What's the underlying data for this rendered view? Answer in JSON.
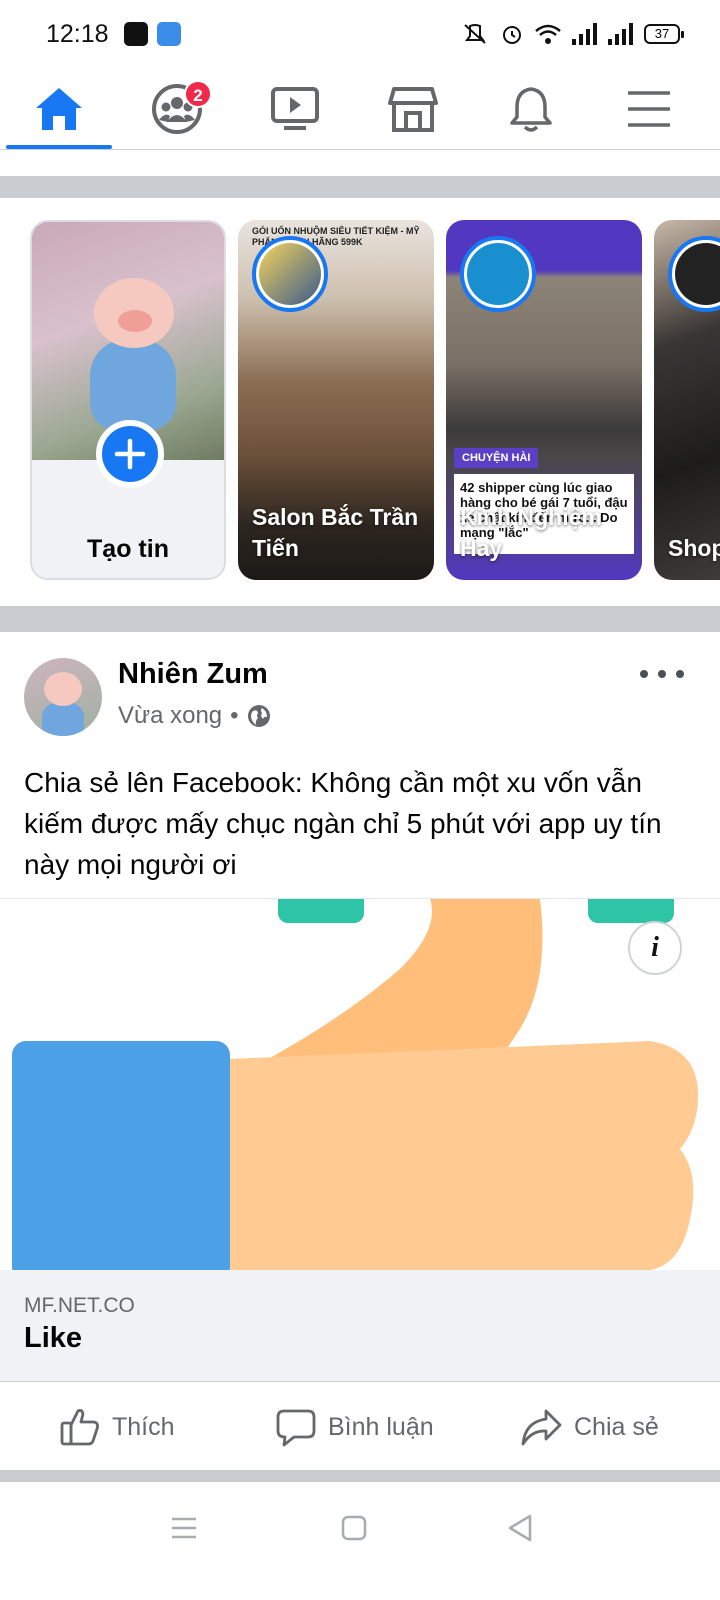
{
  "status_bar": {
    "time": "12:18",
    "battery": "37"
  },
  "nav": {
    "items": [
      {
        "icon": "home-icon",
        "active": true
      },
      {
        "icon": "groups-icon",
        "badge": "2"
      },
      {
        "icon": "watch-icon"
      },
      {
        "icon": "marketplace-icon"
      },
      {
        "icon": "bell-icon"
      },
      {
        "icon": "menu-icon"
      }
    ],
    "accent": "#1877f2"
  },
  "stories": {
    "create_label": "Tạo tin",
    "items": [
      {
        "name": "Salon Bắc Trần Tiến",
        "top_text": "GÓI UỐN NHUỘM SIÊU TIẾT KIỆM - MỸ PHẨM CHÍNH HÃNG 599K"
      },
      {
        "name": "Kinh Nghiệm Hay",
        "tag": "CHUYỆN HÀI",
        "caption": "42 shipper cùng lúc giao hàng cho bé gái 7 tuổi, đậu xe chật kín đến mức... Do mạng \"lắc\""
      },
      {
        "name": "Shop Xinh"
      }
    ]
  },
  "post": {
    "author": "Nhiên Zum",
    "time": "Vừa xong",
    "privacy_icon": "globe-icon",
    "text": "Chia sẻ lên Facebook: Không cần một xu vốn vẫn kiếm được mấy chục ngàn chỉ 5 phút với app uy tín này mọi người ơi",
    "link_domain": "MF.NET.CO",
    "link_title": "Like"
  },
  "actions": {
    "like": "Thích",
    "comment": "Bình luận",
    "share": "Chia sẻ"
  }
}
